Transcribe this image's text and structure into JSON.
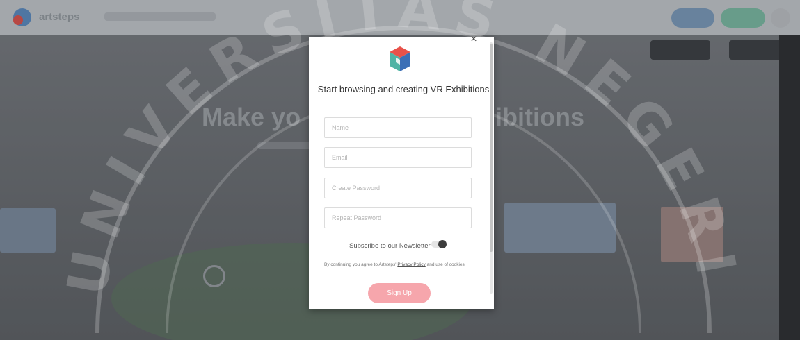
{
  "modal": {
    "title": "Start browsing and creating VR Exhibitions",
    "close_symbol": "×",
    "fields": {
      "name_placeholder": "Name",
      "email_placeholder": "Email",
      "password_placeholder": "Create Password",
      "repeat_password_placeholder": "Repeat Password"
    },
    "newsletter_label": "Subscribe to our Newsletter",
    "newsletter_enabled": true,
    "terms": {
      "prefix": "By continuing you agree to Artsteps'",
      "link": "Privacy Policy",
      "suffix": "and use of cookies."
    },
    "signup_label": "Sign Up"
  },
  "background": {
    "brand": "artsteps",
    "hero_left": "Make yo",
    "hero_right": "ibitions"
  },
  "colors": {
    "primary_button": "#f6a6ac",
    "toggle_knob": "#3d3d3d",
    "logo_red": "#e8524a",
    "logo_teal": "#4fb3a4",
    "logo_blue": "#3b6fb6"
  },
  "watermark": {
    "text": "UNIVERSITAS NEGERI MEDAN"
  }
}
